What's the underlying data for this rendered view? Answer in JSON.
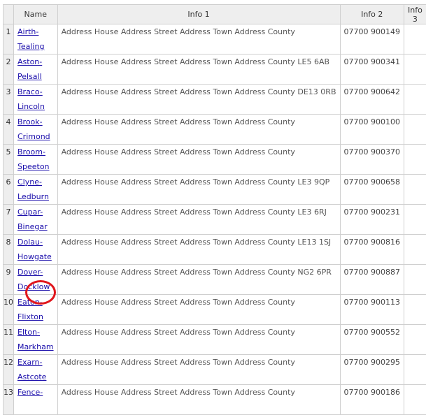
{
  "header": {
    "blank": "",
    "name": "Name",
    "info1": "Info 1",
    "info2": "Info 2",
    "info3": "Info 3"
  },
  "rows": [
    {
      "num": "1",
      "name": "Airth-Tealing",
      "info1": "Address House Address Street Address Town Address County",
      "info2": "07700 900149",
      "info3": ""
    },
    {
      "num": "2",
      "name": "Aston-Pelsall",
      "info1": "Address House Address Street Address Town Address County LE5 6AB",
      "info2": "07700 900341",
      "info3": ""
    },
    {
      "num": "3",
      "name": "Braco-Lincoln",
      "info1": "Address House Address Street Address Town Address County DE13 0RB",
      "info2": "07700 900642",
      "info3": ""
    },
    {
      "num": "4",
      "name": "Brook-Crimond",
      "info1": "Address House Address Street Address Town Address County",
      "info2": "07700 900100",
      "info3": ""
    },
    {
      "num": "5",
      "name": "Broom-Speeton",
      "info1": "Address House Address Street Address Town Address County",
      "info2": "07700 900370",
      "info3": ""
    },
    {
      "num": "6",
      "name": "Clyne-Ledburn",
      "info1": "Address House Address Street Address Town Address County LE3 9QP",
      "info2": "07700 900658",
      "info3": ""
    },
    {
      "num": "7",
      "name": "Cupar-Binegar",
      "info1": "Address House Address Street Address Town Address County LE3 6RJ",
      "info2": "07700 900231",
      "info3": ""
    },
    {
      "num": "8",
      "name": "Dolau-Howgate",
      "info1": "Address House Address Street Address Town Address County LE13 1SJ",
      "info2": "07700 900816",
      "info3": ""
    },
    {
      "num": "9",
      "name": "Dover-Docklow",
      "info1": "Address House Address Street Address Town Address County NG2 6PR",
      "info2": "07700 900887",
      "info3": ""
    },
    {
      "num": "10",
      "name": "Eaton-Flixton",
      "info1": "Address House Address Street Address Town Address County",
      "info2": "07700 900113",
      "info3": ""
    },
    {
      "num": "11",
      "name": "Elton-Markham",
      "info1": "Address House Address Street Address Town Address County",
      "info2": "07700 900552",
      "info3": ""
    },
    {
      "num": "12",
      "name": "Exarn-Astcote",
      "info1": "Address House Address Street Address Town Address County",
      "info2": "07700 900295",
      "info3": ""
    },
    {
      "num": "13",
      "name": "Fence-",
      "info1": "Address House Address Street Address Town Address County",
      "info2": "07700 900186",
      "info3": ""
    }
  ],
  "marker_color": "#e0161c"
}
